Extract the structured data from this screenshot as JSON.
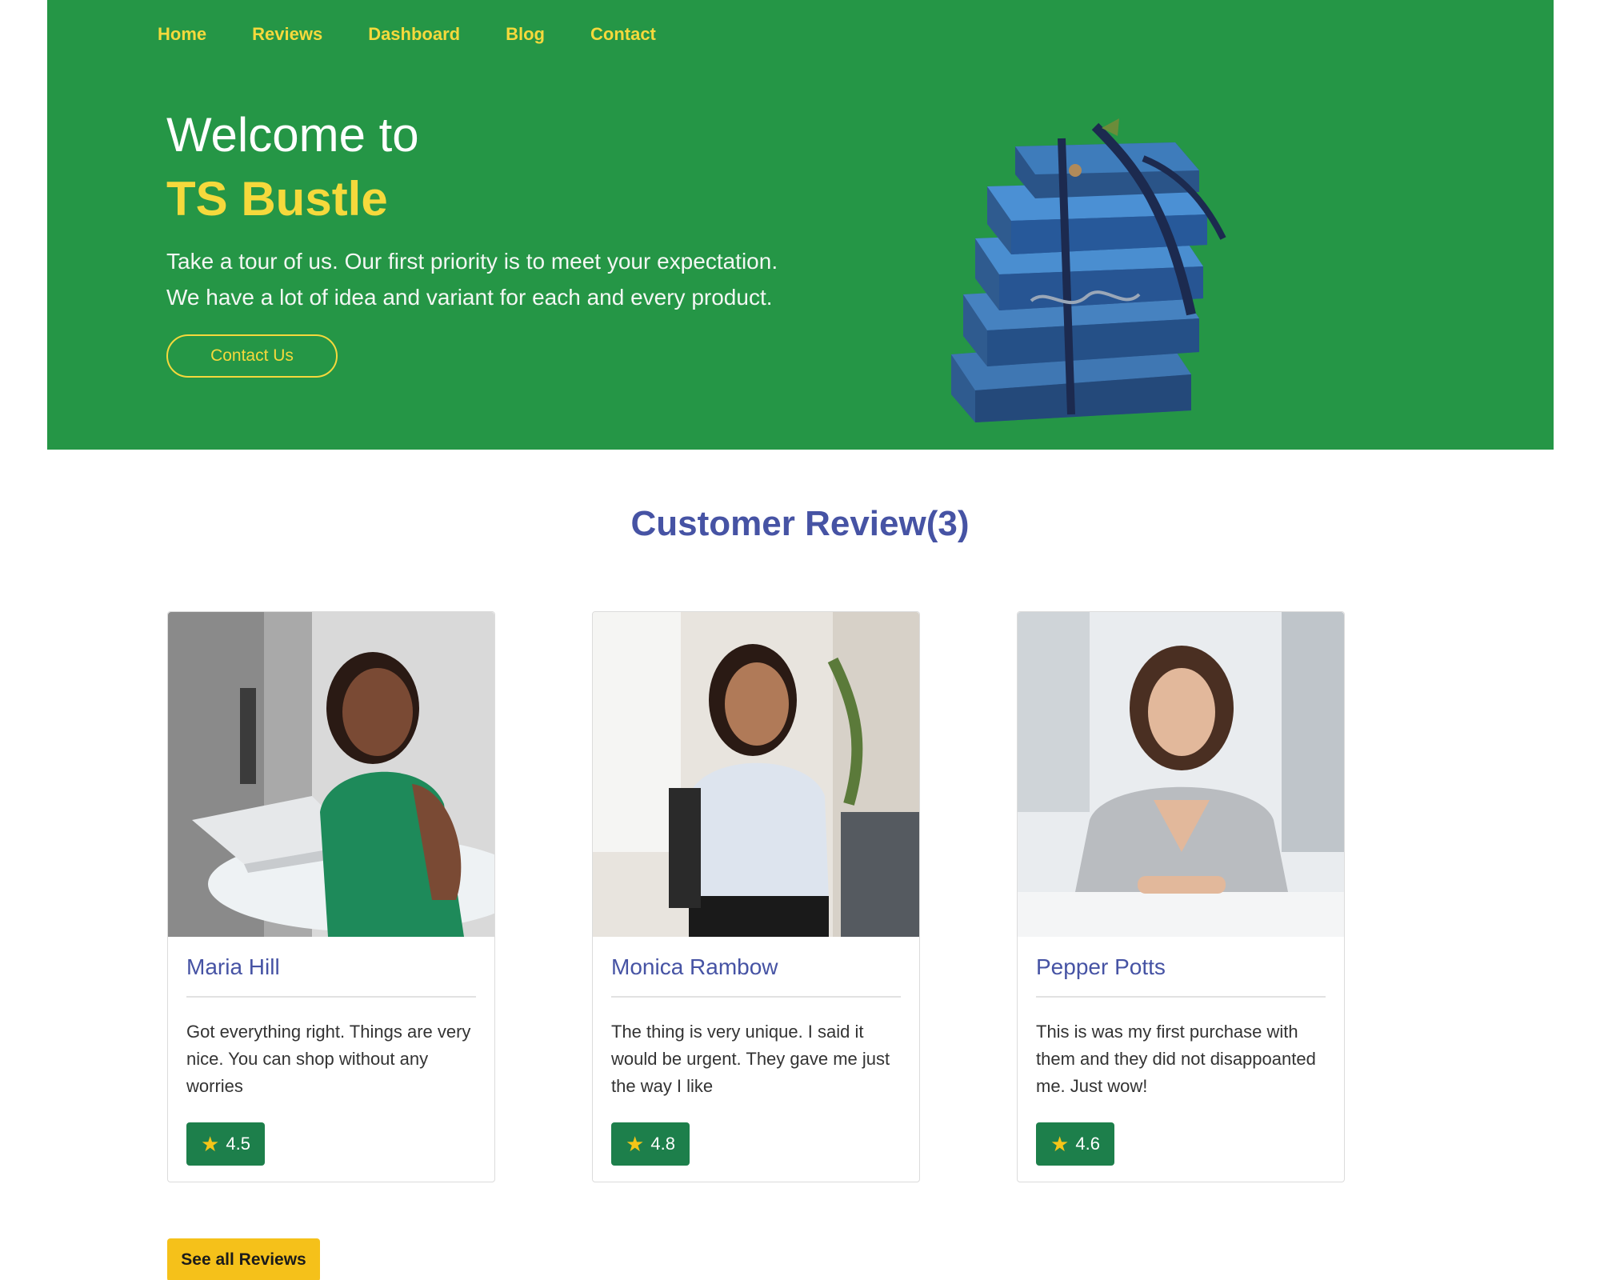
{
  "nav": {
    "items": [
      {
        "label": "Home"
      },
      {
        "label": "Reviews"
      },
      {
        "label": "Dashboard"
      },
      {
        "label": "Blog"
      },
      {
        "label": "Contact"
      }
    ]
  },
  "hero": {
    "welcome": "Welcome to",
    "brand": "TS Bustle",
    "description_line1": "Take a tour of us. Our first priority is to meet your expectation.",
    "description_line2": "We have a lot of idea and variant for each and every product.",
    "contact_label": "Contact Us"
  },
  "reviews": {
    "title": "Customer Review(3)",
    "cards": [
      {
        "name": "Maria Hill",
        "text": "Got everything right. Things are very nice. You can shop without any worries",
        "rating": "4.5"
      },
      {
        "name": "Monica Rambow",
        "text": "The thing is very unique. I said it would be urgent. They gave me just the way I like",
        "rating": "4.8"
      },
      {
        "name": "Pepper Potts",
        "text": "This is was my first purchase with them and they did not disappoanted me. Just wow!",
        "rating": "4.6"
      }
    ],
    "see_all_label": "See all Reviews"
  },
  "colors": {
    "hero_bg": "#259646",
    "accent_yellow": "#f5d93c",
    "title_blue": "#4653a4",
    "rating_green": "#1d7f4b",
    "button_yellow": "#f5c11a"
  },
  "icons": {
    "rating": "star-icon"
  }
}
